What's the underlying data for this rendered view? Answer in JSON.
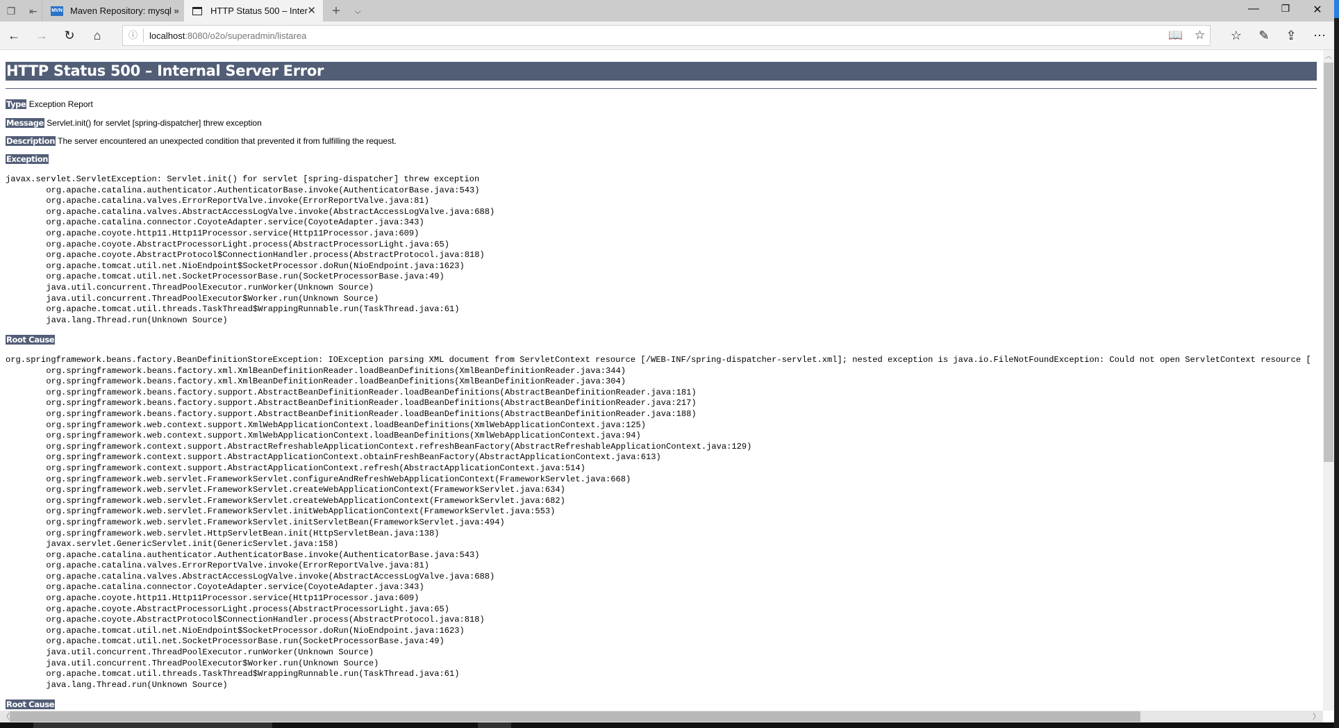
{
  "browser": {
    "tabs": [
      {
        "label": "Maven Repository: mysql »",
        "icon": "mvn-favicon",
        "icon_text": "MVN",
        "active": false
      },
      {
        "label": "HTTP Status 500 – Intern",
        "icon": "page-icon",
        "active": true
      }
    ],
    "url_host": "localhost",
    "url_rest": ":8080/o2o/superadmin/listarea"
  },
  "page": {
    "title": "HTTP Status 500 – Internal Server Error",
    "type_label": "Type",
    "type_value": "Exception Report",
    "message_label": "Message",
    "message_value": "Servlet.init() for servlet [spring-dispatcher] threw exception",
    "description_label": "Description",
    "description_value": "The server encountered an unexpected condition that prevented it from fulfilling the request.",
    "exception_label": "Exception",
    "exception": {
      "head": "javax.servlet.ServletException: Servlet.init() for servlet [spring-dispatcher] threw exception",
      "frames": [
        "org.apache.catalina.authenticator.AuthenticatorBase.invoke(AuthenticatorBase.java:543)",
        "org.apache.catalina.valves.ErrorReportValve.invoke(ErrorReportValve.java:81)",
        "org.apache.catalina.valves.AbstractAccessLogValve.invoke(AbstractAccessLogValve.java:688)",
        "org.apache.catalina.connector.CoyoteAdapter.service(CoyoteAdapter.java:343)",
        "org.apache.coyote.http11.Http11Processor.service(Http11Processor.java:609)",
        "org.apache.coyote.AbstractProcessorLight.process(AbstractProcessorLight.java:65)",
        "org.apache.coyote.AbstractProtocol$ConnectionHandler.process(AbstractProtocol.java:818)",
        "org.apache.tomcat.util.net.NioEndpoint$SocketProcessor.doRun(NioEndpoint.java:1623)",
        "org.apache.tomcat.util.net.SocketProcessorBase.run(SocketProcessorBase.java:49)",
        "java.util.concurrent.ThreadPoolExecutor.runWorker(Unknown Source)",
        "java.util.concurrent.ThreadPoolExecutor$Worker.run(Unknown Source)",
        "org.apache.tomcat.util.threads.TaskThread$WrappingRunnable.run(TaskThread.java:61)",
        "java.lang.Thread.run(Unknown Source)"
      ]
    },
    "root_cause_label": "Root Cause",
    "root_cause": {
      "head": "org.springframework.beans.factory.BeanDefinitionStoreException: IOException parsing XML document from ServletContext resource [/WEB-INF/spring-dispatcher-servlet.xml]; nested exception is java.io.FileNotFoundException: Could not open ServletContext resource [",
      "frames": [
        "org.springframework.beans.factory.xml.XmlBeanDefinitionReader.loadBeanDefinitions(XmlBeanDefinitionReader.java:344)",
        "org.springframework.beans.factory.xml.XmlBeanDefinitionReader.loadBeanDefinitions(XmlBeanDefinitionReader.java:304)",
        "org.springframework.beans.factory.support.AbstractBeanDefinitionReader.loadBeanDefinitions(AbstractBeanDefinitionReader.java:181)",
        "org.springframework.beans.factory.support.AbstractBeanDefinitionReader.loadBeanDefinitions(AbstractBeanDefinitionReader.java:217)",
        "org.springframework.beans.factory.support.AbstractBeanDefinitionReader.loadBeanDefinitions(AbstractBeanDefinitionReader.java:188)",
        "org.springframework.web.context.support.XmlWebApplicationContext.loadBeanDefinitions(XmlWebApplicationContext.java:125)",
        "org.springframework.web.context.support.XmlWebApplicationContext.loadBeanDefinitions(XmlWebApplicationContext.java:94)",
        "org.springframework.context.support.AbstractRefreshableApplicationContext.refreshBeanFactory(AbstractRefreshableApplicationContext.java:129)",
        "org.springframework.context.support.AbstractApplicationContext.obtainFreshBeanFactory(AbstractApplicationContext.java:613)",
        "org.springframework.context.support.AbstractApplicationContext.refresh(AbstractApplicationContext.java:514)",
        "org.springframework.web.servlet.FrameworkServlet.configureAndRefreshWebApplicationContext(FrameworkServlet.java:668)",
        "org.springframework.web.servlet.FrameworkServlet.createWebApplicationContext(FrameworkServlet.java:634)",
        "org.springframework.web.servlet.FrameworkServlet.createWebApplicationContext(FrameworkServlet.java:682)",
        "org.springframework.web.servlet.FrameworkServlet.initWebApplicationContext(FrameworkServlet.java:553)",
        "org.springframework.web.servlet.FrameworkServlet.initServletBean(FrameworkServlet.java:494)",
        "org.springframework.web.servlet.HttpServletBean.init(HttpServletBean.java:138)",
        "javax.servlet.GenericServlet.init(GenericServlet.java:158)",
        "org.apache.catalina.authenticator.AuthenticatorBase.invoke(AuthenticatorBase.java:543)",
        "org.apache.catalina.valves.ErrorReportValve.invoke(ErrorReportValve.java:81)",
        "org.apache.catalina.valves.AbstractAccessLogValve.invoke(AbstractAccessLogValve.java:688)",
        "org.apache.catalina.connector.CoyoteAdapter.service(CoyoteAdapter.java:343)",
        "org.apache.coyote.http11.Http11Processor.service(Http11Processor.java:609)",
        "org.apache.coyote.AbstractProcessorLight.process(AbstractProcessorLight.java:65)",
        "org.apache.coyote.AbstractProtocol$ConnectionHandler.process(AbstractProtocol.java:818)",
        "org.apache.tomcat.util.net.NioEndpoint$SocketProcessor.doRun(NioEndpoint.java:1623)",
        "org.apache.tomcat.util.net.SocketProcessorBase.run(SocketProcessorBase.java:49)",
        "java.util.concurrent.ThreadPoolExecutor.runWorker(Unknown Source)",
        "java.util.concurrent.ThreadPoolExecutor$Worker.run(Unknown Source)",
        "org.apache.tomcat.util.threads.TaskThread$WrappingRunnable.run(TaskThread.java:61)",
        "java.lang.Thread.run(Unknown Source)"
      ]
    },
    "root_cause_label_2": "Root Cause"
  },
  "colors": {
    "tomcat_header": "#525D76",
    "active_tab": "#f2f2f2",
    "tab_strip": "#cccccc"
  }
}
